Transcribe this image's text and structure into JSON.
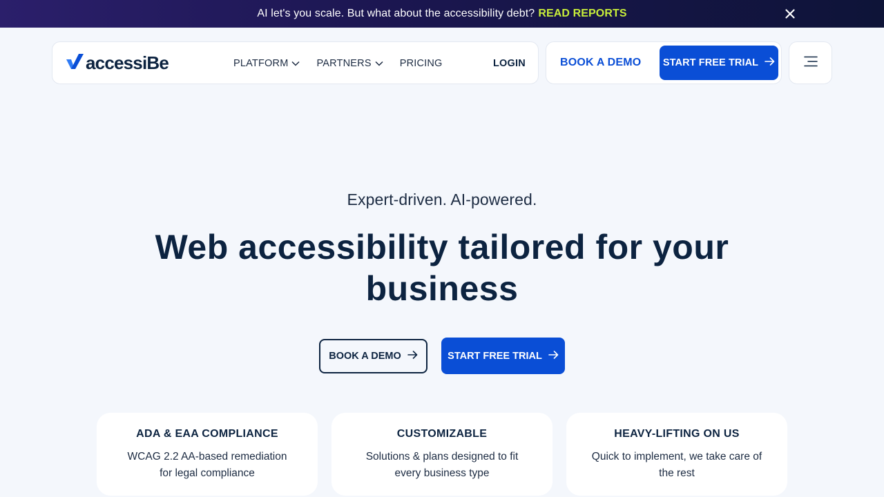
{
  "announcement": {
    "message": "AI let's you scale. But what about the accessibility debt?",
    "cta": "READ REPORTS"
  },
  "header": {
    "logo_text": "accessiBe",
    "menu": [
      {
        "label": "PLATFORM"
      },
      {
        "label": "PARTNERS"
      },
      {
        "label": "PRICING"
      }
    ],
    "login": "LOGIN",
    "book_demo": "BOOK A DEMO",
    "start_trial": "START FREE TRIAL"
  },
  "hero": {
    "eyebrow": "Expert-driven. AI-powered.",
    "headline": "Web accessibility tailored for your business",
    "book_demo": "BOOK A DEMO",
    "start_trial": "START FREE TRIAL"
  },
  "features": [
    {
      "title": "ADA & EAA COMPLIANCE",
      "description": "WCAG 2.2 AA-based remediation for legal compliance"
    },
    {
      "title": "CUSTOMIZABLE",
      "description": "Solutions & plans designed to fit every business type"
    },
    {
      "title": "HEAVY-LIFTING ON US",
      "description": "Quick to implement, we take care of the rest"
    }
  ],
  "colors": {
    "primary_blue": "#0a4ed6",
    "navy_text": "#0c2340",
    "highlight_lime": "#c8ee3a",
    "page_background": "#f4f7fc"
  },
  "icons": {
    "close": "close-icon",
    "chevron": "chevron-down-icon",
    "arrow": "arrow-right-icon",
    "menu": "hamburger-menu-icon",
    "logo": "checkmark-logo-icon"
  }
}
